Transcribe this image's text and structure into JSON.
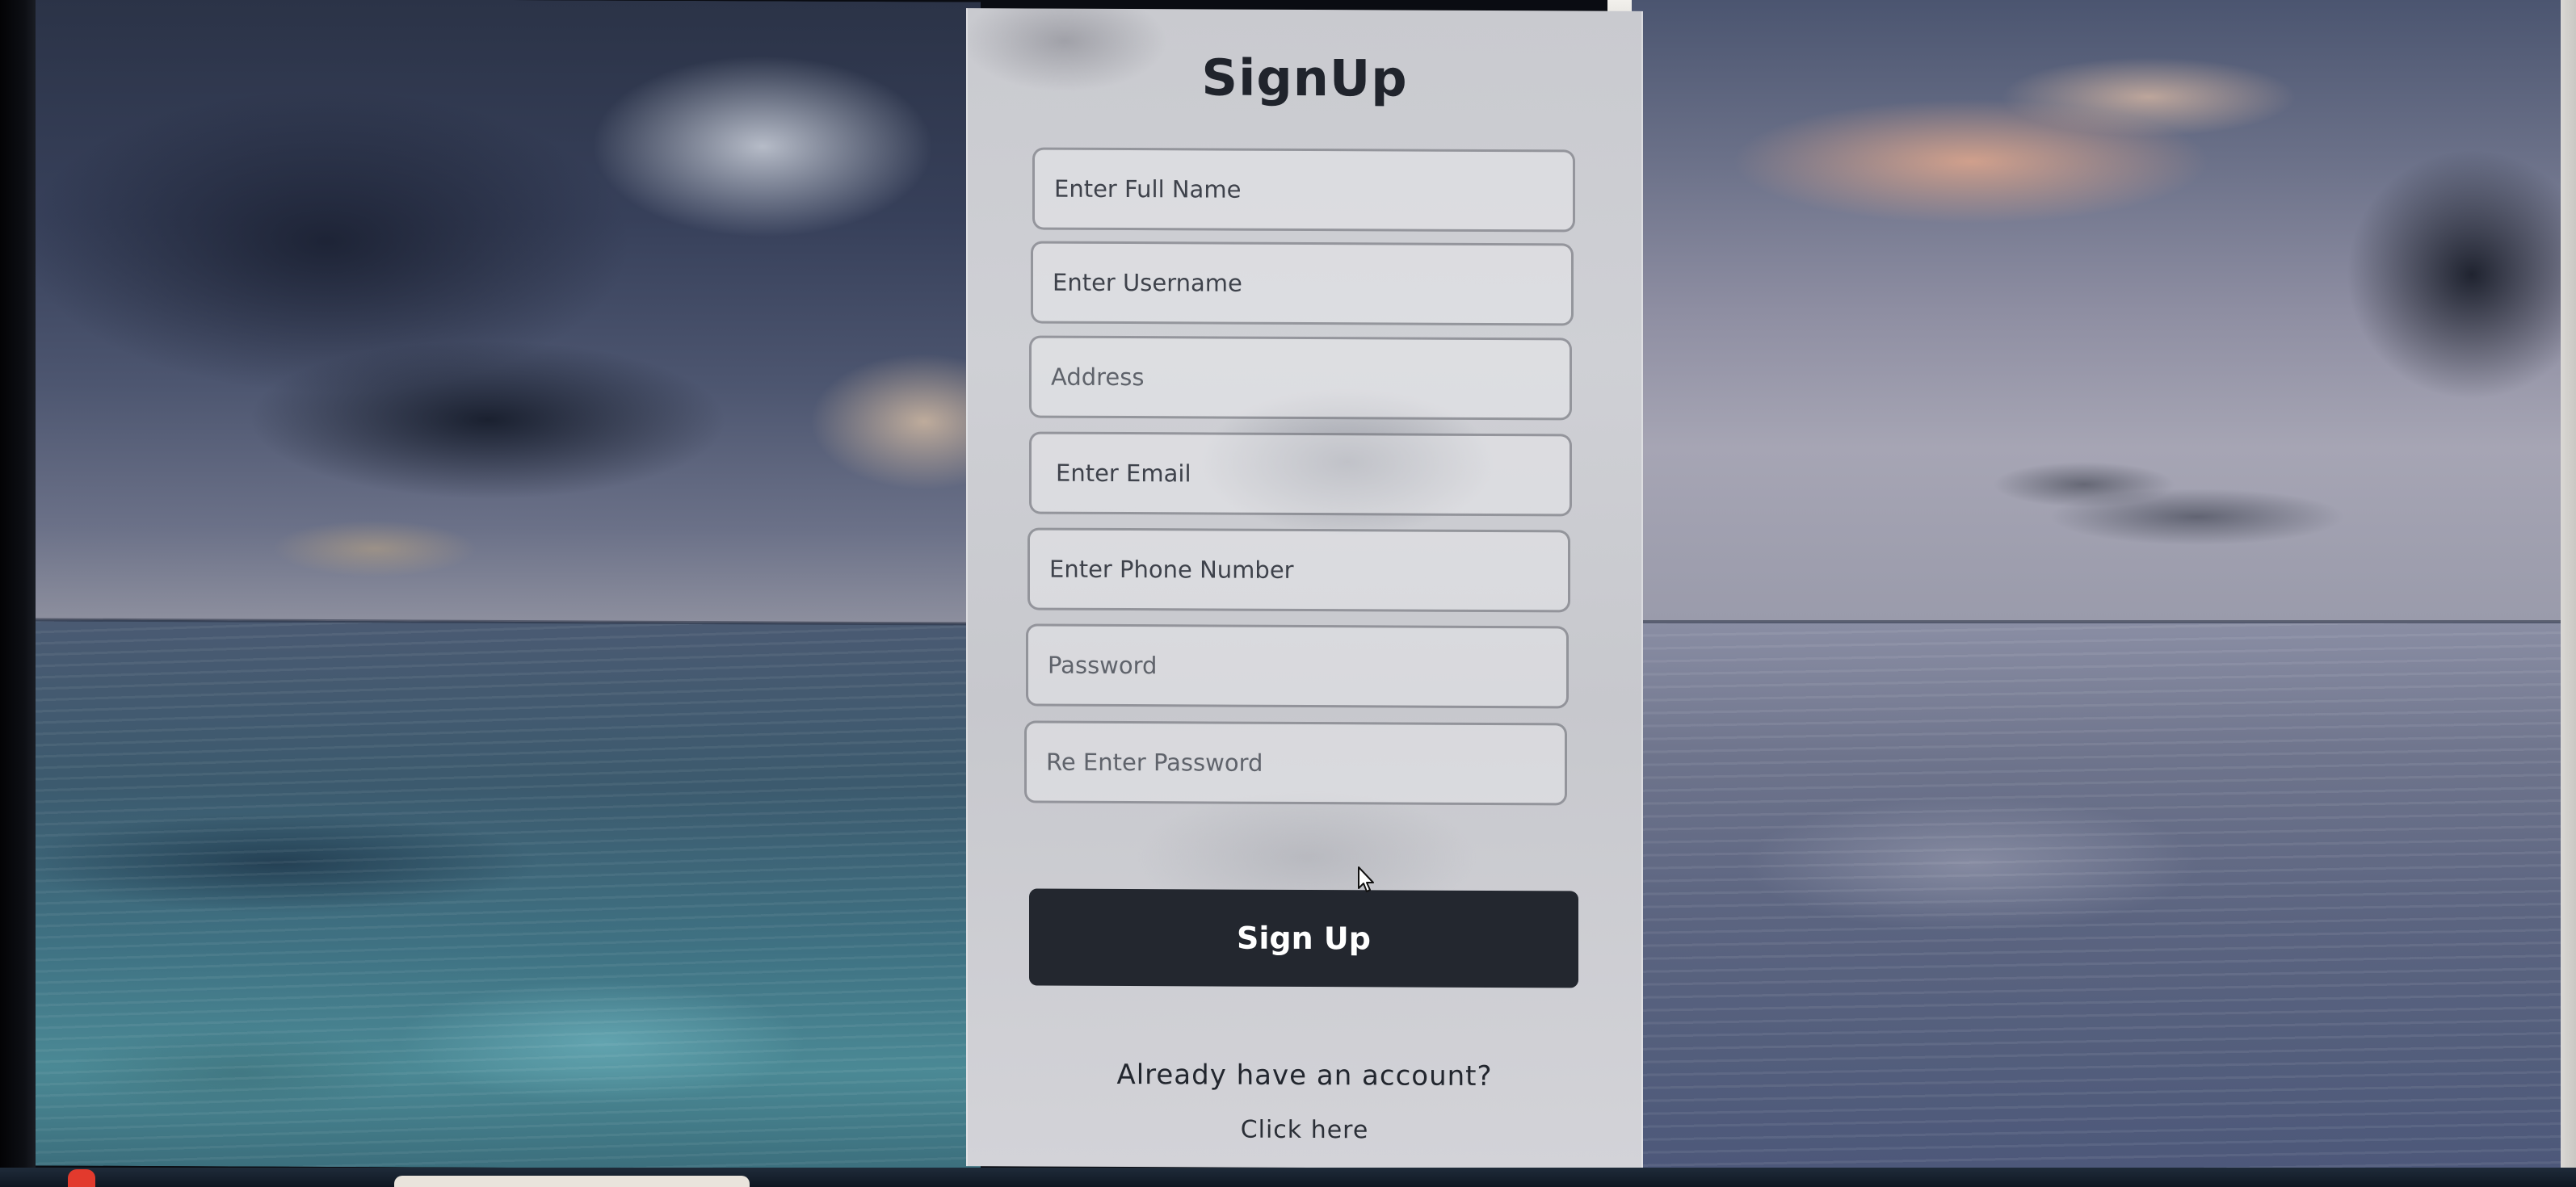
{
  "form": {
    "title": "SignUp",
    "fields": [
      {
        "placeholder": "Enter Full Name",
        "value": ""
      },
      {
        "placeholder": "Enter Username",
        "value": ""
      },
      {
        "placeholder": "Address",
        "value": ""
      },
      {
        "placeholder": "Enter Email",
        "value": ""
      },
      {
        "placeholder": "Enter Phone Number",
        "value": ""
      },
      {
        "placeholder": "Password",
        "value": ""
      },
      {
        "placeholder": "Re Enter Password",
        "value": ""
      }
    ],
    "submit_label": "Sign Up",
    "login_prompt": "Already have an account?",
    "login_link": "Click here"
  },
  "colors": {
    "button_bg": "#23272f",
    "button_text": "#ffffff",
    "title_text": "#20242c",
    "card_bg": "#cfd0d5"
  },
  "icons": {
    "cursor": "mouse-pointer-icon"
  }
}
